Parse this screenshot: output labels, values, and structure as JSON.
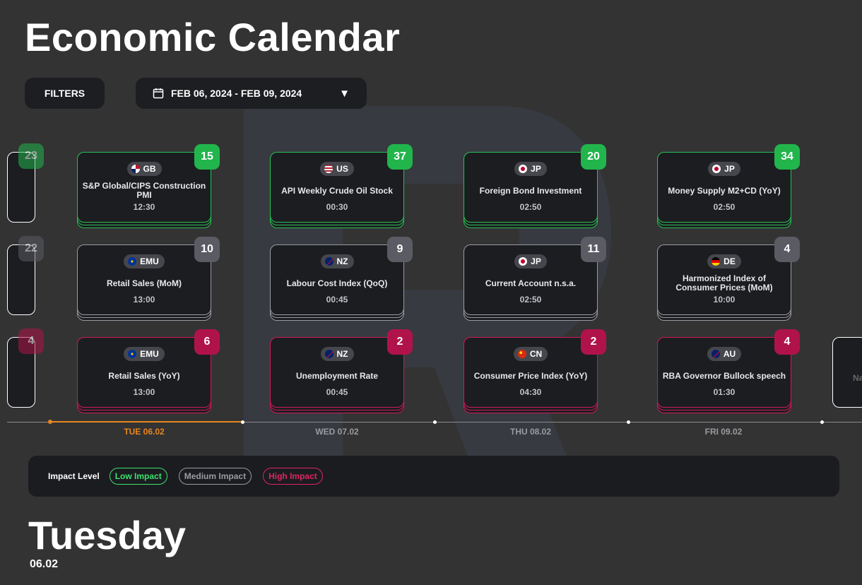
{
  "header": {
    "title": "Economic Calendar"
  },
  "toolbar": {
    "filters_label": "FILTERS",
    "date_range": "FEB 06, 2024 - FEB 09, 2024"
  },
  "left_edge": [
    {
      "count": "23",
      "impact": "low"
    },
    {
      "count": "22",
      "impact": "med"
    },
    {
      "count": "4",
      "impact": "high"
    }
  ],
  "right_edge": {
    "text": "Na",
    "impact": "low"
  },
  "events": [
    {
      "country": "GB",
      "name": "S&P Global/CIPS Construction PMI",
      "time": "12:30",
      "count": "15",
      "impact": "low"
    },
    {
      "country": "US",
      "name": "API Weekly Crude Oil Stock",
      "time": "00:30",
      "count": "37",
      "impact": "low"
    },
    {
      "country": "JP",
      "name": "Foreign Bond Investment",
      "time": "02:50",
      "count": "20",
      "impact": "low"
    },
    {
      "country": "JP",
      "name": "Money Supply M2+CD (YoY)",
      "time": "02:50",
      "count": "34",
      "impact": "low"
    },
    {
      "country": "EMU",
      "name": "Retail Sales (MoM)",
      "time": "13:00",
      "count": "10",
      "impact": "med"
    },
    {
      "country": "NZ",
      "name": "Labour Cost Index (QoQ)",
      "time": "00:45",
      "count": "9",
      "impact": "med"
    },
    {
      "country": "JP",
      "name": "Current Account n.s.a.",
      "time": "02:50",
      "count": "11",
      "impact": "med"
    },
    {
      "country": "DE",
      "name": "Harmonized Index of Consumer Prices (MoM)",
      "time": "10:00",
      "count": "4",
      "impact": "med"
    },
    {
      "country": "EMU",
      "name": "Retail Sales (YoY)",
      "time": "13:00",
      "count": "6",
      "impact": "high"
    },
    {
      "country": "NZ",
      "name": "Unemployment Rate",
      "time": "00:45",
      "count": "2",
      "impact": "high"
    },
    {
      "country": "CN",
      "name": "Consumer Price Index (YoY)",
      "time": "04:30",
      "count": "2",
      "impact": "high"
    },
    {
      "country": "AU",
      "name": "RBA Governor Bullock speech",
      "time": "01:30",
      "count": "4",
      "impact": "high"
    }
  ],
  "timeline": {
    "days": [
      {
        "label": "TUE 06.02",
        "active": true
      },
      {
        "label": "WED 07.02",
        "active": false
      },
      {
        "label": "THU 08.02",
        "active": false
      },
      {
        "label": "FRI 09.02",
        "active": false
      }
    ]
  },
  "legend": {
    "label": "Impact Level",
    "items": [
      {
        "label": "Low Impact",
        "impact": "low"
      },
      {
        "label": "Medium Impact",
        "impact": "med"
      },
      {
        "label": "High Impact",
        "impact": "high"
      }
    ]
  },
  "selected_day": {
    "weekday": "Tuesday",
    "date": "06.02"
  },
  "colors": {
    "low": "#21b54c",
    "medium": "#5a5b63",
    "high": "#b0134a",
    "active_day": "#e8861f"
  },
  "icons": {
    "calendar": "calendar-icon",
    "dropdown": "triangle-down-icon"
  }
}
